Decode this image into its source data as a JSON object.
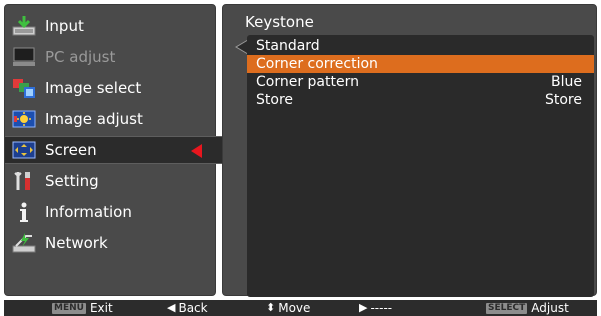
{
  "sidebar": {
    "items": [
      {
        "label": "Input",
        "icon": "input-icon",
        "state": "normal"
      },
      {
        "label": "PC adjust",
        "icon": "pc-adjust-icon",
        "state": "disabled"
      },
      {
        "label": "Image select",
        "icon": "image-select-icon",
        "state": "normal"
      },
      {
        "label": "Image adjust",
        "icon": "image-adjust-icon",
        "state": "normal"
      },
      {
        "label": "Screen",
        "icon": "screen-icon",
        "state": "active"
      },
      {
        "label": "Setting",
        "icon": "setting-icon",
        "state": "normal"
      },
      {
        "label": "Information",
        "icon": "information-icon",
        "state": "normal"
      },
      {
        "label": "Network",
        "icon": "network-icon",
        "state": "normal"
      }
    ]
  },
  "content": {
    "title": "Keystone",
    "rows": [
      {
        "label": "Standard",
        "value": "",
        "selected": false
      },
      {
        "label": "Corner correction",
        "value": "",
        "selected": true
      },
      {
        "label": "Corner pattern",
        "value": "Blue",
        "selected": false
      },
      {
        "label": "Store",
        "value": "Store",
        "selected": false
      }
    ]
  },
  "hints": {
    "exit_key": "MENU",
    "exit": "Exit",
    "back": "Back",
    "move": "Move",
    "next": "-----",
    "adjust_key": "SELECT",
    "adjust": "Adjust"
  },
  "colors": {
    "panel": "#4a4a4a",
    "submenu": "#2a2a2a",
    "highlight": "#dd6d1e",
    "active_arrow": "#e8161e",
    "hint_bar": "#2c2c2c"
  }
}
